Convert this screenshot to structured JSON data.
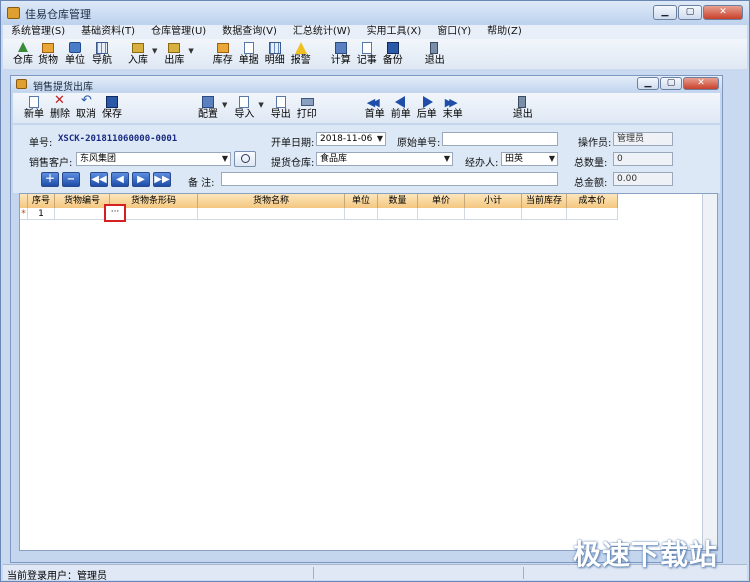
{
  "app": {
    "title": "佳易仓库管理"
  },
  "menu": [
    "系统管理(S)",
    "基础资料(T)",
    "仓库管理(U)",
    "数据查询(V)",
    "汇总统计(W)",
    "实用工具(X)",
    "窗口(Y)",
    "帮助(Z)"
  ],
  "toolbar": {
    "warehouse": "仓库",
    "goods": "货物",
    "unit": "单位",
    "nav": "导航",
    "stock_in": "入库",
    "stock_out": "出库",
    "inventory": "库存",
    "docs": "单据",
    "detail": "明细",
    "alarm": "报警",
    "calc": "计算",
    "notes": "记事",
    "backup": "备份",
    "exit": "退出"
  },
  "child": {
    "title": "销售提货出库",
    "toolbar": {
      "new": "新单",
      "delete": "删除",
      "cancel": "取消",
      "save": "保存",
      "config": "配置",
      "import": "导入",
      "export": "导出",
      "print": "打印",
      "first": "首单",
      "prev": "前单",
      "next": "后单",
      "last": "末单",
      "exit": "退出"
    }
  },
  "form": {
    "bill_no_label": "单号:",
    "bill_no": "XSCK-201811060000-0001",
    "date_label": "开单日期:",
    "date": "2018-11-06",
    "orig_no_label": "原始单号:",
    "orig_no": "",
    "operator_label": "操作员:",
    "operator": "管理员",
    "customer_label": "销售客户:",
    "customer": "东风集团",
    "warehouse_label": "提货仓库:",
    "warehouse": "食品库",
    "handler_label": "经办人:",
    "handler": "田英",
    "total_qty_label": "总数量:",
    "total_qty": "0",
    "remark_label": "备 注:",
    "remark": "",
    "total_amount_label": "总金额:",
    "total_amount": "0.00"
  },
  "grid": {
    "columns": [
      "序号",
      "货物编号",
      "货物条形码",
      "货物名称",
      "单位",
      "数量",
      "单价",
      "小计",
      "当前库存",
      "成本价"
    ],
    "rows": [
      {
        "marker": "*",
        "index": "1",
        "button": "···"
      }
    ]
  },
  "status": {
    "user_label": "当前登录用户：管理员"
  },
  "watermark": "极速下载站",
  "colors": {
    "header_bg": "#f4c780",
    "accent_blue": "#1e4ea8",
    "highlight_red": "#d42020"
  }
}
